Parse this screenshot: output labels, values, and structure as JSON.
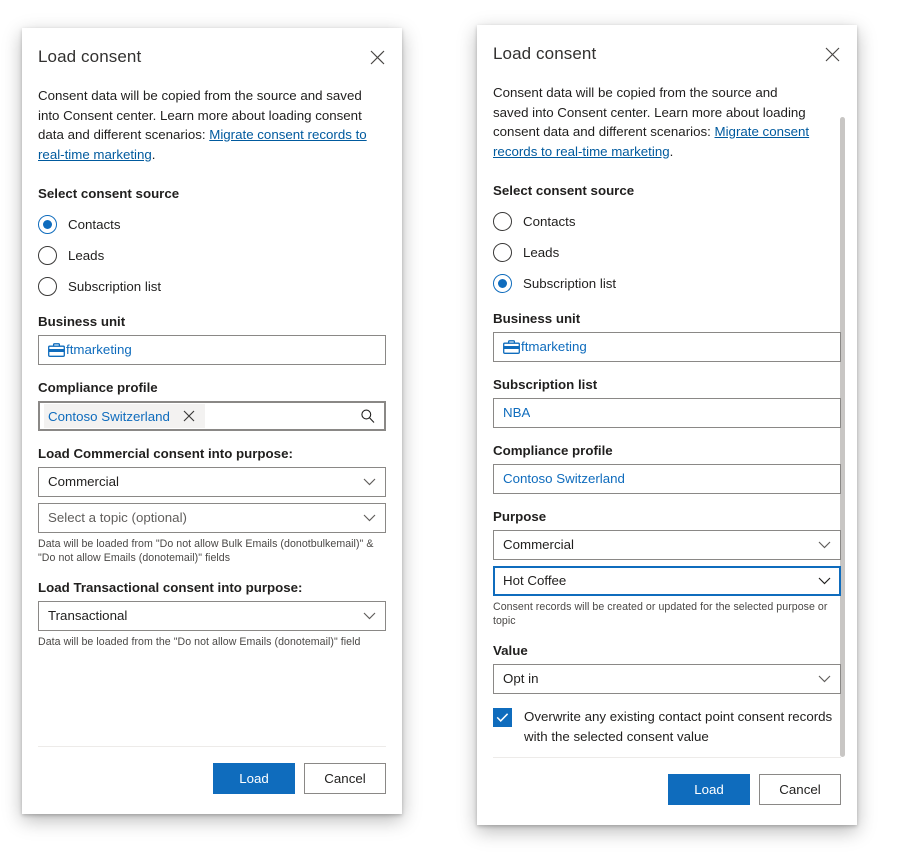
{
  "panels": {
    "left": {
      "title": "Load consent",
      "close_icon": "close-icon",
      "intro": {
        "text_before": "Consent data will be copied from the source and saved into Consent center. Learn more about loading consent data and different scenarios: ",
        "link_text": "Migrate consent records to real-time marketing",
        "text_after": "."
      },
      "consent_source": {
        "label": "Select consent source",
        "options": [
          {
            "label": "Contacts",
            "checked": true
          },
          {
            "label": "Leads",
            "checked": false
          },
          {
            "label": "Subscription list",
            "checked": false
          }
        ]
      },
      "business_unit": {
        "label": "Business unit",
        "value": "ftmarketing",
        "icon": "briefcase-icon"
      },
      "compliance_profile": {
        "label": "Compliance profile",
        "token_value": "Contoso Switzerland",
        "remove_icon": "close-icon",
        "search_icon": "search-icon"
      },
      "commercial_purpose": {
        "label": "Load Commercial consent into purpose:",
        "value": "Commercial",
        "topic_placeholder": "Select a topic (optional)",
        "helper": "Data will be loaded from \"Do not allow Bulk Emails (donotbulkemail)\" & \"Do not allow Emails (donotemail)\" fields"
      },
      "transactional_purpose": {
        "label": "Load Transactional consent into purpose:",
        "value": "Transactional",
        "helper": "Data will be loaded from the \"Do not allow Emails (donotemail)\" field"
      },
      "footer": {
        "primary_label": "Load",
        "secondary_label": "Cancel"
      }
    },
    "right": {
      "title": "Load consent",
      "close_icon": "close-icon",
      "intro": {
        "text_before": "Consent data will be copied from the source and saved into Consent center. Learn more about loading consent data and different scenarios: ",
        "link_text": "Migrate consent records to real-time marketing",
        "text_after": "."
      },
      "consent_source": {
        "label": "Select consent source",
        "options": [
          {
            "label": "Contacts",
            "checked": false
          },
          {
            "label": "Leads",
            "checked": false
          },
          {
            "label": "Subscription list",
            "checked": true
          }
        ]
      },
      "business_unit": {
        "label": "Business unit",
        "value": "ftmarketing",
        "icon": "briefcase-icon"
      },
      "subscription_list": {
        "label": "Subscription list",
        "value": "NBA"
      },
      "compliance_profile": {
        "label": "Compliance profile",
        "value": "Contoso Switzerland"
      },
      "purpose": {
        "label": "Purpose",
        "value": "Commercial",
        "topic_value": "Hot Coffee",
        "helper": "Consent records will be created or updated for the selected purpose or topic"
      },
      "value_field": {
        "label": "Value",
        "value": "Opt in"
      },
      "overwrite_checkbox": {
        "label": "Overwrite any existing contact point consent records with the selected consent value",
        "checked": true
      },
      "footer": {
        "primary_label": "Load",
        "secondary_label": "Cancel"
      },
      "scrollbar": {
        "name": "vertical-scrollbar"
      }
    }
  },
  "colors": {
    "accent": "#0f6cbd",
    "link": "#005a9e",
    "border": "#8a8886",
    "text": "#201f1e"
  }
}
